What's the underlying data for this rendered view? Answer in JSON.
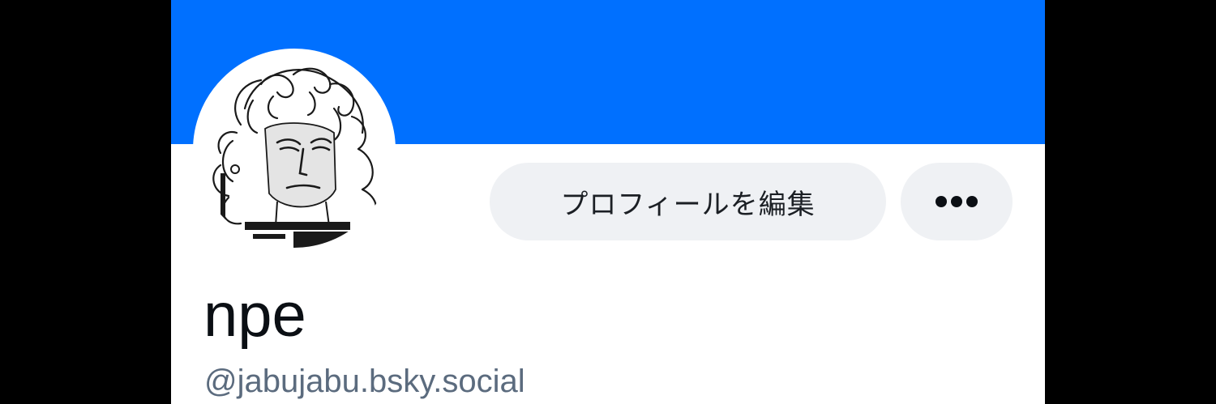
{
  "banner": {
    "color": "#0070ff"
  },
  "avatar": {
    "alt": "avatar-illustration"
  },
  "actions": {
    "edit_profile_label": "プロフィールを編集",
    "more_icon": "ellipsis-icon"
  },
  "profile": {
    "display_name": "npe",
    "handle": "@jabujabu.bsky.social"
  },
  "colors": {
    "banner": "#0070ff",
    "button_bg": "#eff1f4",
    "handle_text": "#5b6b7e",
    "name_text": "#0b0f14"
  }
}
